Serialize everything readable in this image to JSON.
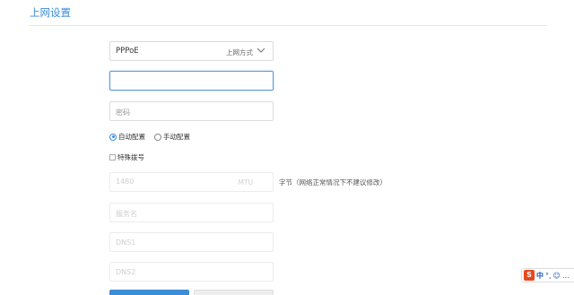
{
  "page": {
    "title": "上网设置"
  },
  "form": {
    "connection_type": {
      "value": "PPPoE",
      "mode_label": "上网方式"
    },
    "username": {
      "value": ""
    },
    "password": {
      "placeholder": "密码"
    },
    "config_mode": {
      "auto_label": "自动配置",
      "manual_label": "手动配置",
      "selected": "auto"
    },
    "special_dial": {
      "label": "特殊拨号",
      "checked": false
    },
    "mtu": {
      "value": "1480",
      "unit": "MTU",
      "hint": "字节（网络正常情况下不建议修改）"
    },
    "service_name": {
      "placeholder": "服务名"
    },
    "dns1": {
      "placeholder": "DNS1"
    },
    "dns2": {
      "placeholder": "DNS2"
    }
  },
  "ime": {
    "lang": "中",
    "icons": [
      "sogou-icon",
      "punctuation-icon",
      "emoji-icon",
      "more-icon"
    ]
  },
  "colors": {
    "accent": "#3b8ed8",
    "ime_brand": "#e8481c"
  }
}
